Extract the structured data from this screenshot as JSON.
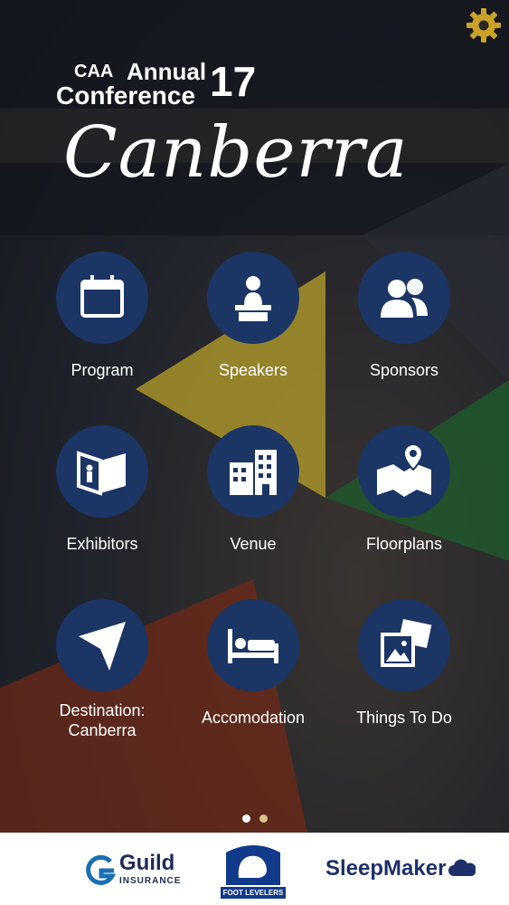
{
  "header": {
    "logo_org": "CAA",
    "logo_annual": "Annual",
    "logo_conference": "Conference",
    "logo_year": "17",
    "logo_city": "Canberra"
  },
  "menu": [
    {
      "label": "Program",
      "icon": "calendar-icon"
    },
    {
      "label": "Speakers",
      "icon": "speaker-podium-icon"
    },
    {
      "label": "Sponsors",
      "icon": "people-icon"
    },
    {
      "label": "Exhibitors",
      "icon": "exhibit-booth-icon"
    },
    {
      "label": "Venue",
      "icon": "building-icon"
    },
    {
      "label": "Floorplans",
      "icon": "map-pin-icon"
    },
    {
      "label": "Destination:\nCanberra",
      "icon": "navigation-arrow-icon"
    },
    {
      "label": "Accomodation",
      "icon": "bed-icon"
    },
    {
      "label": "Things To Do",
      "icon": "photos-icon"
    }
  ],
  "pager": {
    "total": 2,
    "active": 1
  },
  "sponsors": {
    "guild": {
      "name": "Guild",
      "sub": "INSURANCE"
    },
    "foot": {
      "name": "FOOT LEVELERS"
    },
    "sleep": {
      "name": "SleepMaker"
    }
  },
  "colors": {
    "circle": "#1b3565",
    "gear": "#c9a227",
    "dot_active": "#ffffff",
    "dot_inactive": "#d8c48a",
    "footer": "#ffffff"
  }
}
